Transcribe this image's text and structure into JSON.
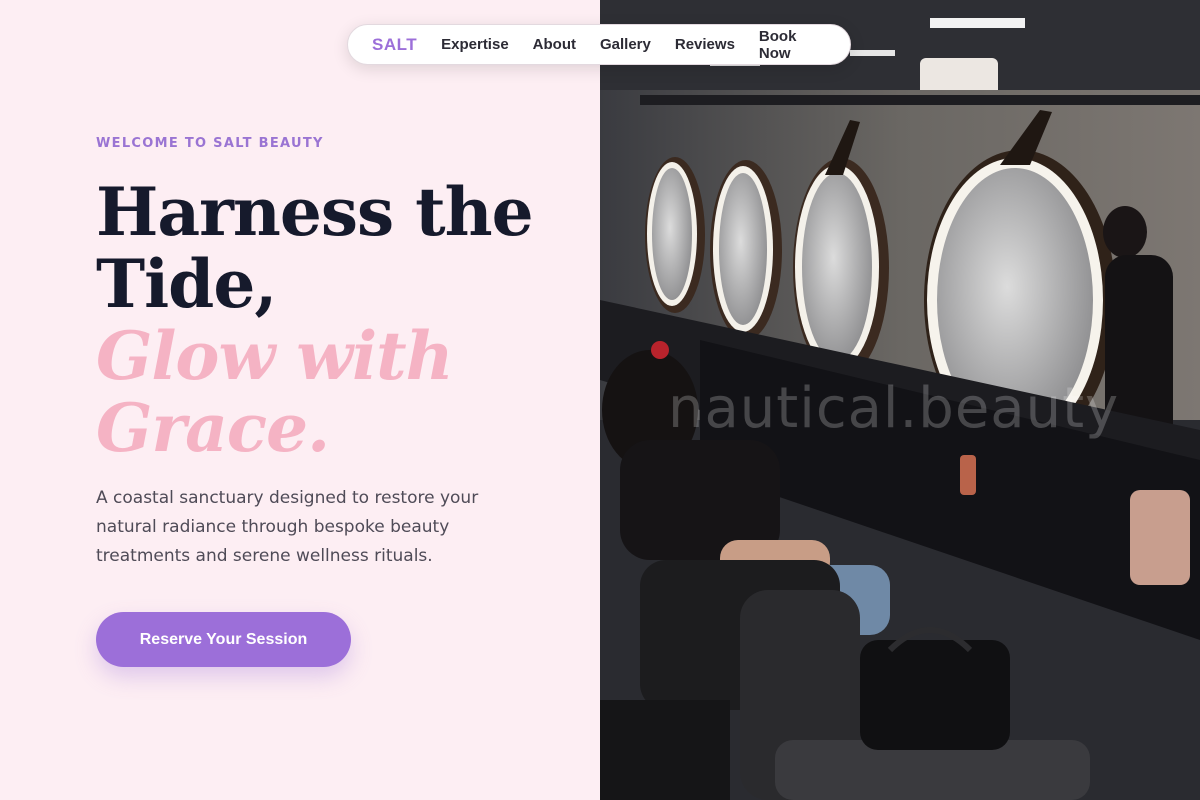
{
  "nav": {
    "logo": "SALT",
    "links": [
      "Expertise",
      "About",
      "Gallery",
      "Reviews",
      "Book Now"
    ]
  },
  "hero": {
    "eyebrow": "WELCOME TO SALT BEAUTY",
    "headline_line1": "Harness the",
    "headline_line2": "Tide,",
    "accent_line1": "Glow with",
    "accent_line2": "Grace.",
    "description": "A coastal sanctuary designed to restore your natural radiance through bespoke beauty treatments and serene wellness rituals.",
    "cta_label": "Reserve Your Session"
  },
  "photo": {
    "subject": "salon interior with lit round mirrors and styling chairs",
    "watermark": "nautical.beauty"
  },
  "colors": {
    "background": "#fdeef3",
    "accent_purple": "#9c6fd9",
    "accent_pink": "#f5b3c4",
    "heading": "#161a2c",
    "body_text": "#4f4b57"
  }
}
